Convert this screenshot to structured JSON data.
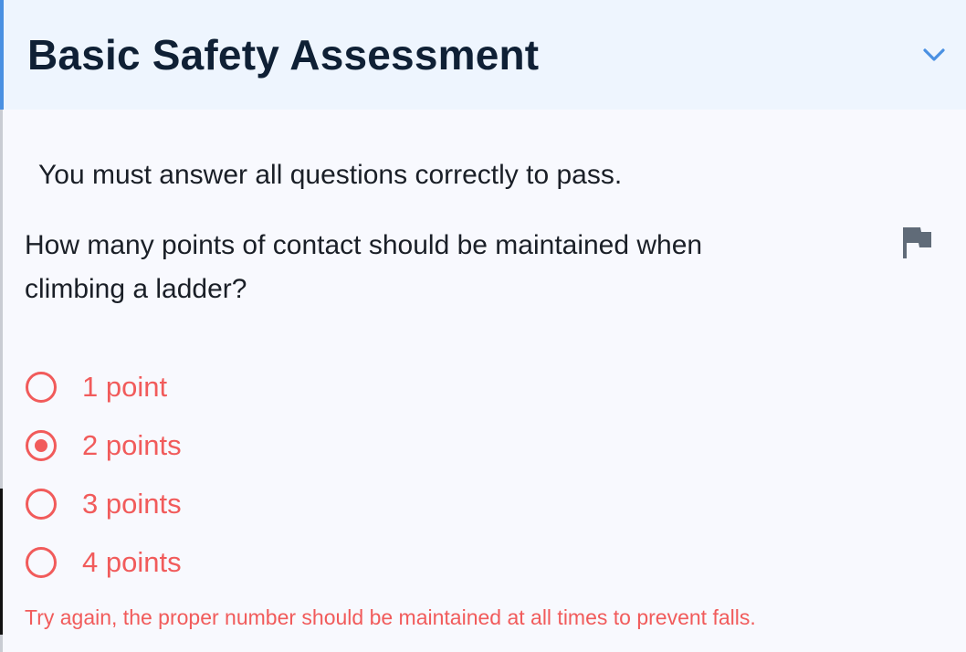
{
  "quiz": {
    "title": "Basic Safety Assessment",
    "instructions": "You must answer all questions correctly to pass.",
    "question": "How many points of contact should be maintained when climbing a ladder?",
    "options": [
      {
        "label": "1 point",
        "selected": false
      },
      {
        "label": "2 points",
        "selected": true
      },
      {
        "label": "3 points",
        "selected": false
      },
      {
        "label": "4 points",
        "selected": false
      }
    ],
    "feedback": "Try again, the proper number should be maintained at all times to prevent falls."
  },
  "icons": {
    "collapse": "chevron-down-icon",
    "flag": "flag-icon"
  },
  "colors": {
    "accent": "#4a90e2",
    "error": "#f15b5b",
    "title": "#0f2035",
    "text": "#1a1f27",
    "header_bg": "#eef5fe",
    "body_bg": "#f8f9fe",
    "flag": "#606b78"
  }
}
